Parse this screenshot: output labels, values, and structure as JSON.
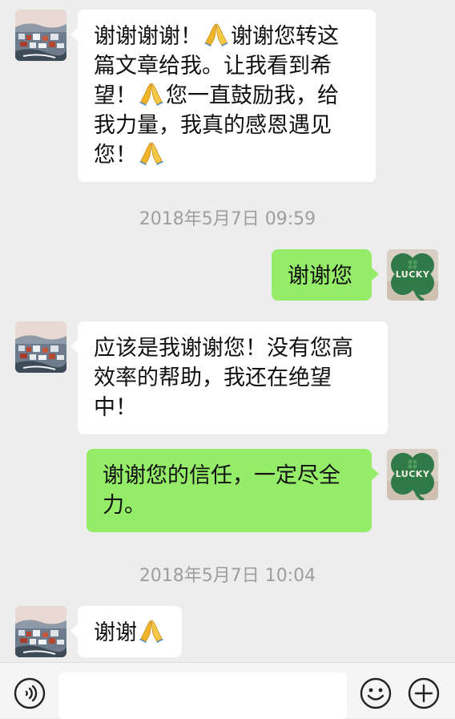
{
  "conversation": {
    "messages": [
      {
        "side": "in",
        "segments": [
          {
            "text": "谢谢谢谢！"
          },
          {
            "emoji": "folded-hands"
          },
          {
            "text": "谢谢您转这篇文章给我。让我看到希望！"
          },
          {
            "emoji": "folded-hands"
          },
          {
            "text": "您一直鼓励我，给我力量，我真的感恩遇见您！"
          },
          {
            "emoji": "folded-hands"
          }
        ]
      },
      {
        "timestamp": "2018年5月7日 09:59"
      },
      {
        "side": "out",
        "text": "谢谢您"
      },
      {
        "side": "in",
        "text": "应该是我谢谢您！没有您高效率的帮助，我还在绝望中！"
      },
      {
        "side": "out",
        "text": "谢谢您的信任，一定尽全力。"
      },
      {
        "timestamp": "2018年5月7日 10:04"
      },
      {
        "side": "in",
        "segments": [
          {
            "text": "谢谢"
          },
          {
            "emoji": "folded-hands"
          }
        ]
      }
    ]
  },
  "avatars": {
    "contact": {
      "icon": "landscape-town-photo"
    },
    "self": {
      "icon": "clover-lucky",
      "label": "LUCKY"
    }
  },
  "input_bar": {
    "voice_icon": "voice-icon",
    "text_value": "",
    "emoji_icon": "smiley-icon",
    "plus_icon": "plus-icon"
  },
  "colors": {
    "background": "#ededed",
    "incoming_bubble": "#ffffff",
    "outgoing_bubble": "#95ec69",
    "timestamp_text": "#9e9e9e"
  }
}
